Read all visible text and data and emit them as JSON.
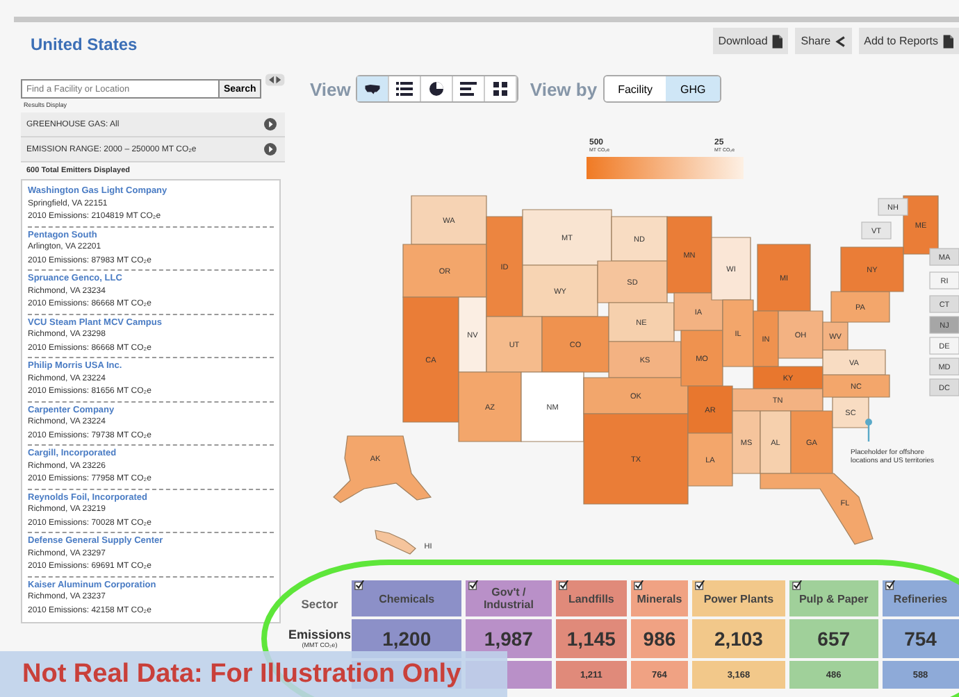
{
  "header": {
    "title": "United States",
    "buttons": [
      {
        "label": "Download",
        "kind": "doc"
      },
      {
        "label": "Share",
        "kind": "share"
      },
      {
        "label": "Add to Reports",
        "kind": "doc"
      }
    ]
  },
  "search": {
    "placeholder": "Find a Facility or Location",
    "button": "Search"
  },
  "results_label": "Results Display",
  "filters": [
    {
      "label": "GREENHOUSE GAS: All"
    },
    {
      "label": "EMISSION RANGE: 2000 – 250000 MT CO₂e"
    }
  ],
  "total": "600 Total Emitters Displayed",
  "facilities": [
    {
      "name": "Washington Gas Light Company",
      "city": "Springfield, VA 22151",
      "emissions": "2010 Emissions: 2104819 MT CO₂e"
    },
    {
      "name": "Pentagon South",
      "city": "Arlington, VA 22201",
      "emissions": "2010 Emissions: 87983 MT CO₂e"
    },
    {
      "name": "Spruance Genco, LLC",
      "city": "Richmond, VA 23234",
      "emissions": "2010 Emissions: 86668 MT CO₂e"
    },
    {
      "name": "VCU Steam Plant MCV Campus",
      "city": "Richmond, VA 23298",
      "emissions": "2010 Emissions: 86668 MT CO₂e"
    },
    {
      "name": "Philip Morris USA Inc.",
      "city": "Richmond, VA 23224",
      "emissions": "2010 Emissions: 81656 MT CO₂e"
    },
    {
      "name": "Carpenter Company",
      "city": "Richmond, VA 23224",
      "emissions": "2010 Emissions: 79738 MT CO₂e"
    },
    {
      "name": "Cargill, Incorporated",
      "city": "Richmond, VA 23226",
      "emissions": "2010 Emissions: 77958 MT CO₂e"
    },
    {
      "name": "Reynolds Foil, Incorporated",
      "city": "Richmond, VA 23219",
      "emissions": "2010 Emissions: 70028 MT CO₂e"
    },
    {
      "name": "Defense General Supply Center",
      "city": "Richmond, VA 23297",
      "emissions": "2010 Emissions: 69691 MT CO₂e"
    },
    {
      "name": "Kaiser Aluminum Corporation",
      "city": "Richmond, VA 23237",
      "emissions": "2010 Emissions: 42158 MT CO₂e"
    }
  ],
  "view": {
    "label": "View",
    "buttons": [
      {
        "kind": "map",
        "selected": true
      },
      {
        "kind": "list",
        "selected": false
      },
      {
        "kind": "pie",
        "selected": false
      },
      {
        "kind": "bars",
        "selected": false
      },
      {
        "kind": "grid",
        "selected": false
      }
    ]
  },
  "view_by": {
    "label": "View by",
    "options": [
      {
        "label": "Facility",
        "selected": false
      },
      {
        "label": "GHG",
        "selected": true
      }
    ]
  },
  "legend": {
    "max_label": "500",
    "max_unit": "MT CO₂e",
    "min_label": "25",
    "min_unit": "MT CO₂e"
  },
  "states": [
    {
      "label": "WA",
      "color": "#f6d3b4"
    },
    {
      "label": "OR",
      "color": "#f3a66b"
    },
    {
      "label": "CA",
      "color": "#ea7d37"
    },
    {
      "label": "NV",
      "color": "#fbeee3"
    },
    {
      "label": "ID",
      "color": "#ec8540"
    },
    {
      "label": "MT",
      "color": "#f9e4d1"
    },
    {
      "label": "WY",
      "color": "#f7d4b3"
    },
    {
      "label": "UT",
      "color": "#f5bb8c"
    },
    {
      "label": "CO",
      "color": "#ef924f"
    },
    {
      "label": "AZ",
      "color": "#f3a66b"
    },
    {
      "label": "NM",
      "color": "#ffffff"
    },
    {
      "label": "ND",
      "color": "#f8dcc2"
    },
    {
      "label": "SD",
      "color": "#f5c49c"
    },
    {
      "label": "NE",
      "color": "#f6d0ad"
    },
    {
      "label": "KS",
      "color": "#f3b282"
    },
    {
      "label": "OK",
      "color": "#f2a66c"
    },
    {
      "label": "TX",
      "color": "#ea7d37"
    },
    {
      "label": "MN",
      "color": "#ea7d37"
    },
    {
      "label": "IA",
      "color": "#f3b282"
    },
    {
      "label": "MO",
      "color": "#ef924f"
    },
    {
      "label": "AR",
      "color": "#e8772e"
    },
    {
      "label": "LA",
      "color": "#f3a66b"
    },
    {
      "label": "WI",
      "color": "#fae6d6"
    },
    {
      "label": "IL",
      "color": "#f3a66b"
    },
    {
      "label": "MI",
      "color": "#ea7d37"
    },
    {
      "label": "IN",
      "color": "#ef924f"
    },
    {
      "label": "OH",
      "color": "#f3b282"
    },
    {
      "label": "KY",
      "color": "#e8772e"
    },
    {
      "label": "TN",
      "color": "#f3b282"
    },
    {
      "label": "MS",
      "color": "#f5c49c"
    },
    {
      "label": "AL",
      "color": "#f6d0ad"
    },
    {
      "label": "GA",
      "color": "#ef924f"
    },
    {
      "label": "FL",
      "color": "#f3a66b"
    },
    {
      "label": "SC",
      "color": "#f8dcc2"
    },
    {
      "label": "VA",
      "color": "#f8dcc2"
    },
    {
      "label": "NC",
      "color": "#f3a66b"
    },
    {
      "label": "WV",
      "color": "#f3b282"
    },
    {
      "label": "PA",
      "color": "#f3a66b"
    },
    {
      "label": "NY",
      "color": "#ea7d37"
    },
    {
      "label": "ME",
      "color": "#ea7d37"
    },
    {
      "label": "AK",
      "color": "#f3a66b"
    },
    {
      "label": "HI",
      "color": "#f5c49c"
    }
  ],
  "callouts": [
    {
      "label": "NH",
      "color": "#e6e6e6"
    },
    {
      "label": "VT",
      "color": "#e6e6e6"
    },
    {
      "label": "MA",
      "color": "#dcdcdc"
    },
    {
      "label": "RI",
      "color": "#f4f4f4"
    },
    {
      "label": "CT",
      "color": "#dcdcdc"
    },
    {
      "label": "NJ",
      "color": "#a6a6a6"
    },
    {
      "label": "DE",
      "color": "#f4f4f4"
    },
    {
      "label": "MD",
      "color": "#e0e0e0"
    },
    {
      "label": "DC",
      "color": "#dcdcdc"
    }
  ],
  "offshore_note": [
    "Placeholder for offshore",
    "locations and US territories"
  ],
  "sector_table": {
    "row_labels": [
      "Sector",
      "Emissions",
      "(MMT CO₂e)"
    ],
    "sectors": [
      {
        "name": "Chemicals",
        "color": "#8c90c8",
        "checked": true,
        "emissions": "1,200"
      },
      {
        "name": "Gov't / Industrial",
        "color": "#b990c8",
        "checked": true,
        "emissions": "1,987"
      },
      {
        "name": "Landfills",
        "color": "#e08a7a",
        "checked": true,
        "emissions": "1,145",
        "row_3": "1,211"
      },
      {
        "name": "Minerals",
        "color": "#f0a283",
        "checked": true,
        "emissions": "986",
        "row_3": "764"
      },
      {
        "name": "Power Plants",
        "color": "#f2c88a",
        "checked": true,
        "emissions": "2,103",
        "row_3": "3,168"
      },
      {
        "name": "Pulp & Paper",
        "color": "#a0d09a",
        "checked": true,
        "emissions": "657",
        "row_3": "486"
      },
      {
        "name": "Refineries",
        "color": "#8eaad8",
        "checked": true,
        "emissions": "754",
        "row_3": "588"
      }
    ]
  },
  "annotation": "Not Real Data: For Illustration Only"
}
